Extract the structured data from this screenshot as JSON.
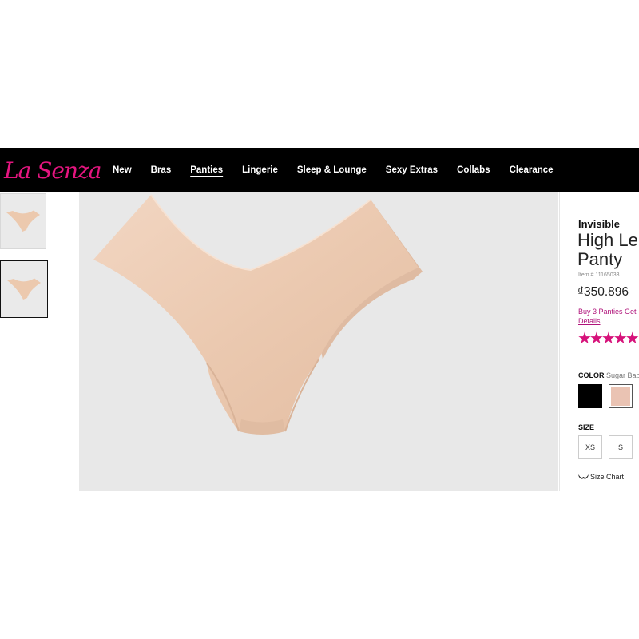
{
  "brand": {
    "logo_text": "La Senza",
    "accent_color": "#e4157f"
  },
  "nav": {
    "items": [
      {
        "label": "New"
      },
      {
        "label": "Bras"
      },
      {
        "label": "Panties"
      },
      {
        "label": "Lingerie"
      },
      {
        "label": "Sleep & Lounge"
      },
      {
        "label": "Sexy Extras"
      },
      {
        "label": "Collabs"
      },
      {
        "label": "Clearance"
      }
    ],
    "active": "Panties"
  },
  "product": {
    "line": "Invisible",
    "name": "High Le\nPanty",
    "item_number": "Item # 11165033",
    "price": "₫350.896",
    "promo": "Buy 3 Panties Get",
    "details_link": "Details",
    "stars": "★★★★★",
    "color_label": "COLOR",
    "color_value": "Sugar Bab",
    "swatches": [
      {
        "name": "black",
        "color": "#000000"
      },
      {
        "name": "sugar-baby",
        "color": "#eac3b3",
        "selected": true
      }
    ],
    "size_label": "SIZE",
    "sizes": [
      "XS",
      "S"
    ],
    "size_chart": "Size Chart"
  },
  "icons": [
    "bra-icon",
    "star-icon"
  ]
}
